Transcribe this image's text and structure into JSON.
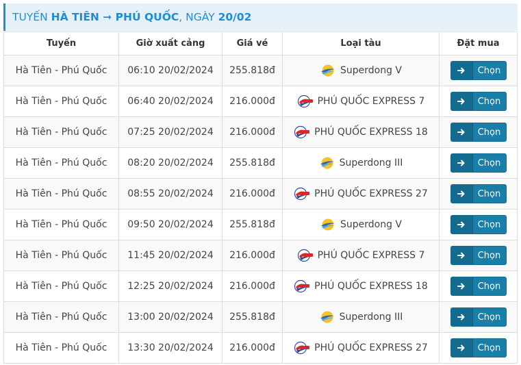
{
  "header": {
    "prefix": "TUYẾN ",
    "route": "HÀ TIÊN ➞ PHÚ QUỐC",
    "date_prefix": ", NGÀY ",
    "date": "20/02"
  },
  "columns": [
    "Tuyến",
    "Giờ xuất cảng",
    "Giá vé",
    "Loại tàu",
    "Đặt mua"
  ],
  "button_label": "Chọn",
  "colors": {
    "accent": "#1f8dd6",
    "price": "#e53935",
    "button": "#1a7fa8"
  },
  "rows": [
    {
      "route": "Hà Tiên - Phú Quốc",
      "departure": "06:10 20/02/2024",
      "price": "255.818đ",
      "ship": "Superdong V",
      "logo": "superdong-logo-icon"
    },
    {
      "route": "Hà Tiên - Phú Quốc",
      "departure": "06:40 20/02/2024",
      "price": "216.000đ",
      "ship": "PHÚ QUỐC EXPRESS 7",
      "logo": "phuquoc-express-logo-icon"
    },
    {
      "route": "Hà Tiên - Phú Quốc",
      "departure": "07:25 20/02/2024",
      "price": "216.000đ",
      "ship": "PHÚ QUỐC EXPRESS 18",
      "logo": "phuquoc-express-logo-icon"
    },
    {
      "route": "Hà Tiên - Phú Quốc",
      "departure": "08:20 20/02/2024",
      "price": "255.818đ",
      "ship": "Superdong III",
      "logo": "superdong-logo-icon"
    },
    {
      "route": "Hà Tiên - Phú Quốc",
      "departure": "08:55 20/02/2024",
      "price": "216.000đ",
      "ship": "PHÚ QUỐC EXPRESS 27",
      "logo": "phuquoc-express-logo-icon"
    },
    {
      "route": "Hà Tiên - Phú Quốc",
      "departure": "09:50 20/02/2024",
      "price": "255.818đ",
      "ship": "Superdong V",
      "logo": "superdong-logo-icon"
    },
    {
      "route": "Hà Tiên - Phú Quốc",
      "departure": "11:45 20/02/2024",
      "price": "216.000đ",
      "ship": "PHÚ QUỐC EXPRESS 7",
      "logo": "phuquoc-express-logo-icon"
    },
    {
      "route": "Hà Tiên - Phú Quốc",
      "departure": "12:25 20/02/2024",
      "price": "216.000đ",
      "ship": "PHÚ QUỐC EXPRESS 18",
      "logo": "phuquoc-express-logo-icon"
    },
    {
      "route": "Hà Tiên - Phú Quốc",
      "departure": "13:00 20/02/2024",
      "price": "255.818đ",
      "ship": "Superdong III",
      "logo": "superdong-logo-icon"
    },
    {
      "route": "Hà Tiên - Phú Quốc",
      "departure": "13:30 20/02/2024",
      "price": "216.000đ",
      "ship": "PHÚ QUỐC EXPRESS 27",
      "logo": "phuquoc-express-logo-icon"
    }
  ]
}
